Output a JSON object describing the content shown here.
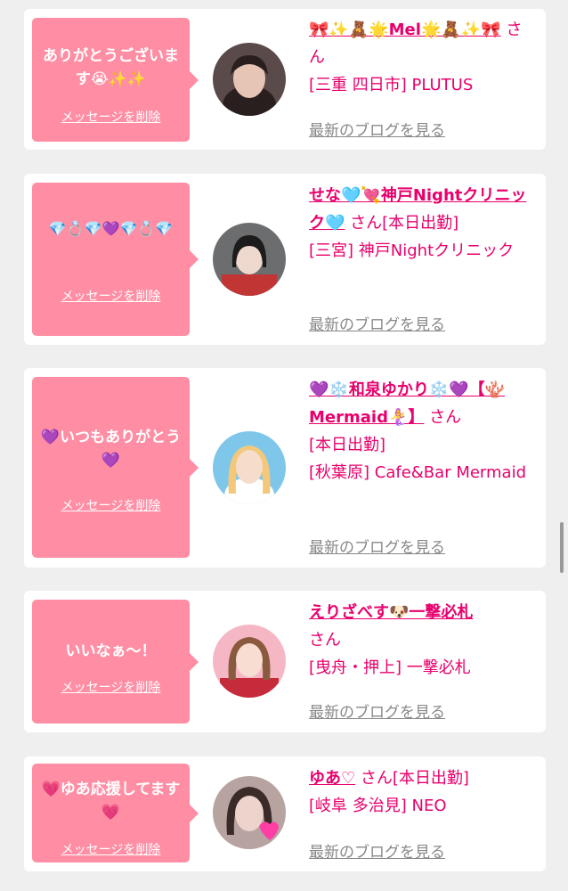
{
  "cards": [
    {
      "message": "ありがとうございます😭✨✨",
      "delete_label": "メッセージを削除",
      "name": "🎀✨🧸🌟Mel🌟🧸✨🎀",
      "honorific": "さん",
      "status": "",
      "area": "[三重 四日市] PLUTUS",
      "blog_link": "最新のブログを見る",
      "avatar_colors": [
        "#5a4a4a",
        "#e7c5b5",
        "#2a1f1f"
      ]
    },
    {
      "message": "💎💍💎💜💎💍💎",
      "delete_label": "メッセージを削除",
      "name": "せな🩵💘神戸Nightクリニック🩵",
      "honorific": "さん",
      "status": "[本日出勤]",
      "area": "[三宮] 神戸Nightクリニック",
      "blog_link": "最新のブログを見る",
      "avatar_colors": [
        "#6b6d6f",
        "#efd9cf",
        "#1d1c1c"
      ]
    },
    {
      "message": "💜いつもありがとう💜",
      "delete_label": "メッセージを削除",
      "name": "💜❄️和泉ゆかり❄️💜【🪸Mermaid🧜‍♀️】",
      "honorific": "さん",
      "status": "[本日出勤]",
      "area": "[秋葉原] Cafe&Bar Mermaid",
      "blog_link": "最新のブログを見る",
      "avatar_colors": [
        "#7fc7ea",
        "#f6dccb",
        "#f3c87b"
      ]
    },
    {
      "message": "いいなぁ〜！",
      "delete_label": "メッセージを削除",
      "name": "えりざべす🐶一撃必札",
      "honorific": "さん",
      "status": "",
      "area": "[曳舟・押上] 一撃必札",
      "blog_link": "最新のブログを見る",
      "avatar_colors": [
        "#f5b7c4",
        "#f7ddd2",
        "#8a5a3e"
      ]
    },
    {
      "message": "💗ゆあ応援してます💗",
      "delete_label": "メッセージを削除",
      "name": "ゆあ♡",
      "honorific": "さん",
      "status": "[本日出勤]",
      "area": "[岐阜 多治見] NEO",
      "blog_link": "最新のブログを見る",
      "avatar_colors": [
        "#b7a3a0",
        "#ecd3cb",
        "#3a2a28"
      ]
    }
  ]
}
